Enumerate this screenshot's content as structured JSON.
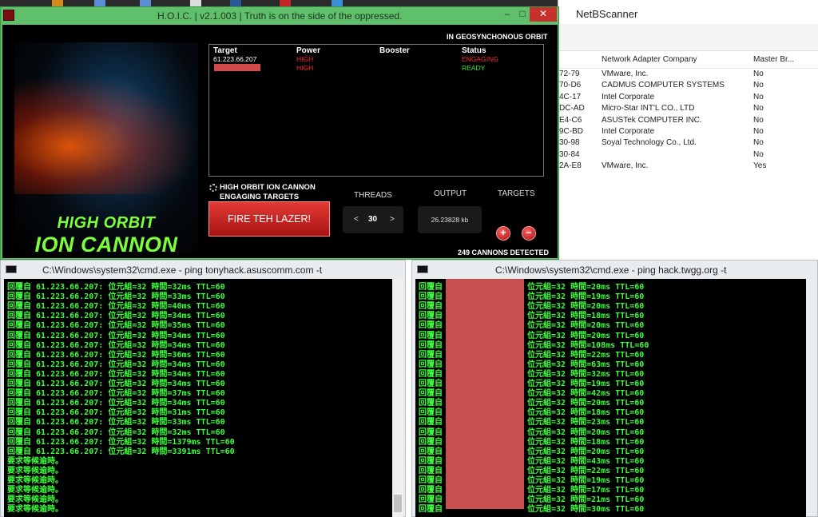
{
  "hoic": {
    "title": "H.O.I.C. | v2.1.003 | Truth is on the side of the oppressed.",
    "window_controls": {
      "minimize": "–",
      "maximize": "□",
      "close": "✕"
    },
    "orbit_label": "IN GEOSYNCHONOUS ORBIT",
    "poster": {
      "line1": "HIGH ORBIT",
      "line2": "ION CANNON"
    },
    "table": {
      "headers": [
        "Target",
        "Power",
        "Booster",
        "Status"
      ],
      "rows": [
        {
          "target": "61.223.66.207",
          "power": "HIGH",
          "booster": "",
          "status": "ENGAGING"
        },
        {
          "target": "",
          "power": "HIGH",
          "booster": "",
          "status": "READY"
        }
      ]
    },
    "status_line1": "HIGH ORBIT ION CANNON",
    "status_line2": "ENGAGING TARGETS",
    "fire_button": "FIRE TEH LAZER!",
    "threads_label": "THREADS",
    "threads_value": "30",
    "threads_dec": "<",
    "threads_inc": ">",
    "output_label": "OUTPUT",
    "output_value": "26.23828 kb",
    "targets_label": "TARGETS",
    "add_target": "+",
    "remove_target": "−",
    "cannons_detected": "249 CANNONS DETECTED",
    "colors": {
      "frame": "#5fbf6a",
      "high": "#ff2a2a",
      "ready": "#39e639",
      "fire": "#c82320"
    }
  },
  "netbscanner": {
    "title": "NetBScanner",
    "headers": [
      "Network Adapter Company",
      "Master Br..."
    ],
    "rows": [
      {
        "mac": "72-79",
        "company": "VMware, Inc.",
        "master": "No"
      },
      {
        "mac": "70-D6",
        "company": "CADMUS COMPUTER SYSTEMS",
        "master": "No"
      },
      {
        "mac": "4C-17",
        "company": "Intel Corporate",
        "master": "No"
      },
      {
        "mac": "DC-AD",
        "company": "Micro-Star INT'L CO., LTD",
        "master": "No"
      },
      {
        "mac": "E4-C6",
        "company": "ASUSTek COMPUTER INC.",
        "master": "No"
      },
      {
        "mac": "9C-BD",
        "company": "Intel Corporate",
        "master": "No"
      },
      {
        "mac": "30-98",
        "company": "Soyal Technology Co., Ltd.",
        "master": "No"
      },
      {
        "mac": "30-84",
        "company": "",
        "master": "No"
      },
      {
        "mac": "2A-E8",
        "company": "VMware, Inc.",
        "master": "Yes"
      }
    ]
  },
  "cmd_left": {
    "title": "C:\\Windows\\system32\\cmd.exe - ping  tonyhack.asuscomm.com -t",
    "lines": [
      "回覆自 61.223.66.207: 位元組=32 時間=32ms TTL=60",
      "回覆自 61.223.66.207: 位元組=32 時間=33ms TTL=60",
      "回覆自 61.223.66.207: 位元組=32 時間=40ms TTL=60",
      "回覆自 61.223.66.207: 位元組=32 時間=34ms TTL=60",
      "回覆自 61.223.66.207: 位元組=32 時間=35ms TTL=60",
      "回覆自 61.223.66.207: 位元組=32 時間=34ms TTL=60",
      "回覆自 61.223.66.207: 位元組=32 時間=34ms TTL=60",
      "回覆自 61.223.66.207: 位元組=32 時間=36ms TTL=60",
      "回覆自 61.223.66.207: 位元組=32 時間=34ms TTL=60",
      "回覆自 61.223.66.207: 位元組=32 時間=34ms TTL=60",
      "回覆自 61.223.66.207: 位元組=32 時間=34ms TTL=60",
      "回覆自 61.223.66.207: 位元組=32 時間=37ms TTL=60",
      "回覆自 61.223.66.207: 位元組=32 時間=34ms TTL=60",
      "回覆自 61.223.66.207: 位元組=32 時間=31ms TTL=60",
      "回覆自 61.223.66.207: 位元組=32 時間=33ms TTL=60",
      "回覆自 61.223.66.207: 位元組=32 時間=32ms TTL=60",
      "回覆自 61.223.66.207: 位元組=32 時間=1379ms TTL=60",
      "回覆自 61.223.66.207: 位元組=32 時間=3391ms TTL=60",
      "要求等候逾時。",
      "要求等候逾時。",
      "要求等候逾時。",
      "要求等候逾時。",
      "要求等候逾時。",
      "要求等候逾時。"
    ]
  },
  "cmd_right": {
    "title": "C:\\Windows\\system32\\cmd.exe - ping  hack.twgg.org -t",
    "prefix": "回覆自",
    "lines": [
      "位元組=32 時間=20ms TTL=60",
      "位元組=32 時間=19ms TTL=60",
      "位元組=32 時間=20ms TTL=60",
      "位元組=32 時間=18ms TTL=60",
      "位元組=32 時間=20ms TTL=60",
      "位元組=32 時間=20ms TTL=60",
      "位元組=32 時間=108ms TTL=60",
      "位元組=32 時間=22ms TTL=60",
      "位元組=32 時間=63ms TTL=60",
      "位元組=32 時間=32ms TTL=60",
      "位元組=32 時間=19ms TTL=60",
      "位元組=32 時間=42ms TTL=60",
      "位元組=32 時間=20ms TTL=60",
      "位元組=32 時間=18ms TTL=60",
      "位元組=32 時間=23ms TTL=60",
      "位元組=32 時間=20ms TTL=60",
      "位元組=32 時間=18ms TTL=60",
      "位元組=32 時間=20ms TTL=60",
      "位元組=32 時間=43ms TTL=60",
      "位元組=32 時間=22ms TTL=60",
      "位元組=32 時間=19ms TTL=60",
      "位元組=32 時間=17ms TTL=60",
      "位元組=32 時間=21ms TTL=60",
      "位元組=32 時間=30ms TTL=60"
    ]
  }
}
